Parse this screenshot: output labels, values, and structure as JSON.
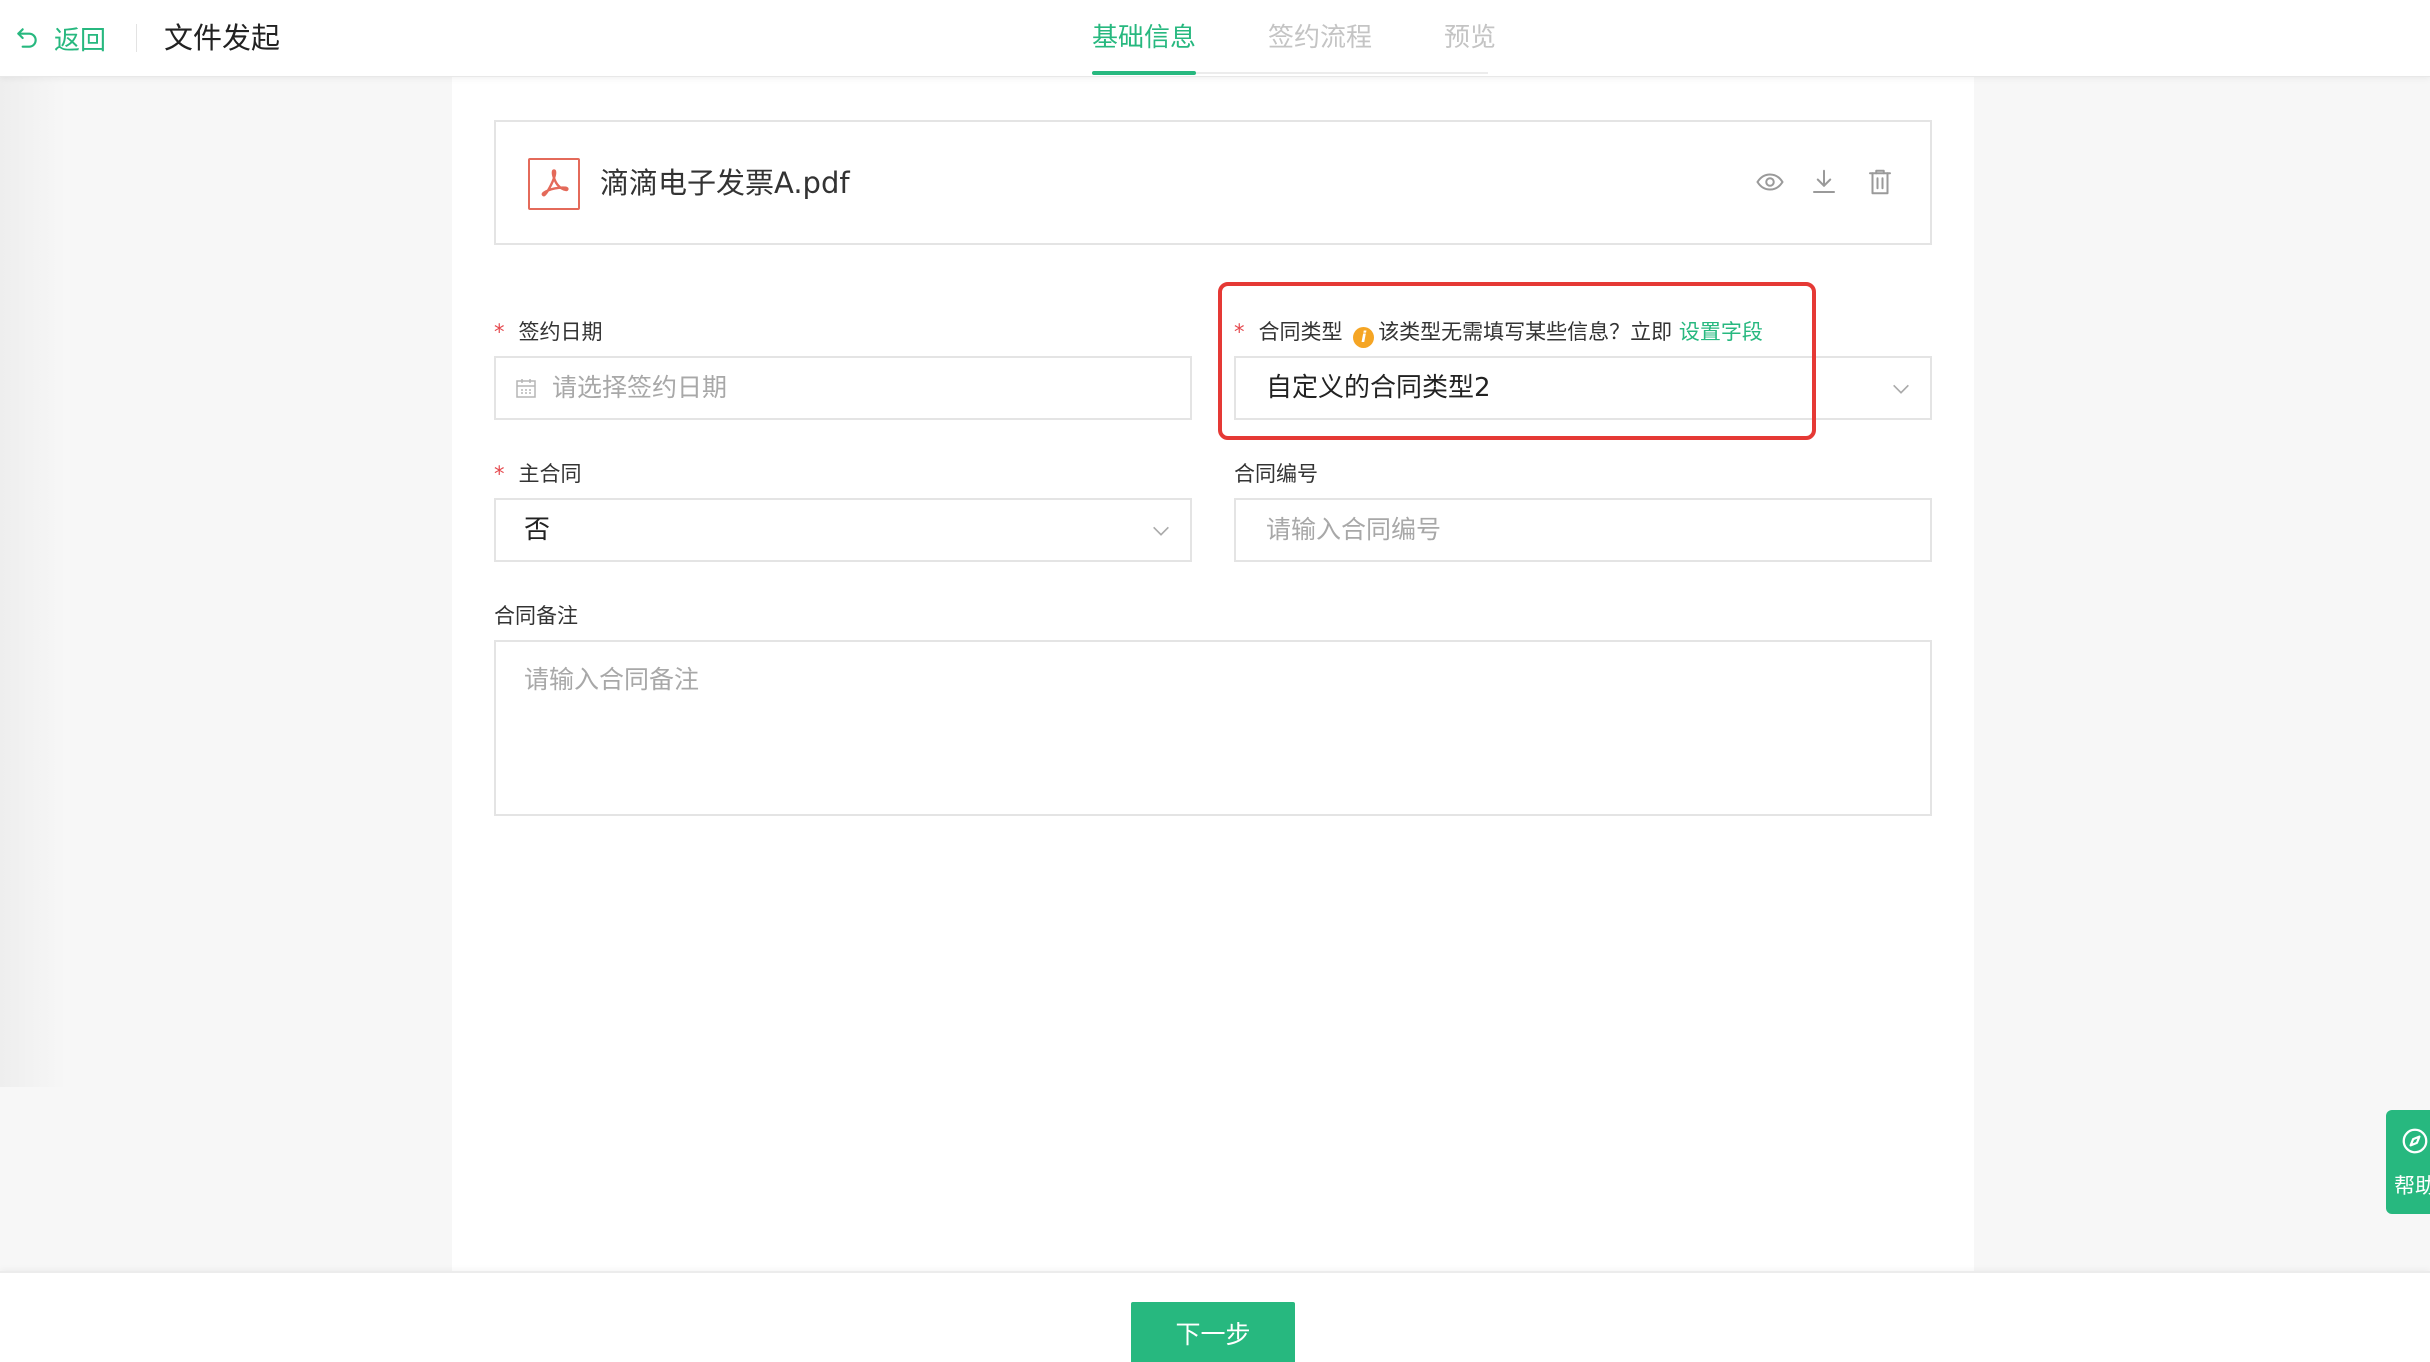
{
  "header": {
    "back_label": "返回",
    "title": "文件发起",
    "tabs": [
      {
        "label": "基础信息",
        "active": true
      },
      {
        "label": "签约流程",
        "active": false
      },
      {
        "label": "预览",
        "active": false
      }
    ]
  },
  "file": {
    "name": "滴滴电子发票A.pdf",
    "icon": "pdf-icon",
    "actions": [
      "eye-icon",
      "download-icon",
      "trash-icon"
    ]
  },
  "form": {
    "sign_date": {
      "label": "签约日期",
      "required": true,
      "placeholder": "请选择签约日期",
      "icon": "calendar-icon"
    },
    "contract_type": {
      "label": "合同类型",
      "required": true,
      "hint": "该类型无需填写某些信息？立即",
      "hint_link": "设置字段",
      "value": "自定义的合同类型2"
    },
    "main_contract": {
      "label": "主合同",
      "required": true,
      "value": "否"
    },
    "contract_no": {
      "label": "合同编号",
      "required": false,
      "placeholder": "请输入合同编号"
    },
    "remark": {
      "label": "合同备注",
      "required": false,
      "placeholder": "请输入合同备注"
    }
  },
  "footer": {
    "next_label": "下一步"
  },
  "help": {
    "label": "帮助",
    "icon": "compass-icon"
  },
  "colors": {
    "accent": "#27b87f",
    "required": "#e5484d",
    "highlight": "#e53935",
    "info": "#f5a524",
    "pdf": "#e46a5a"
  }
}
